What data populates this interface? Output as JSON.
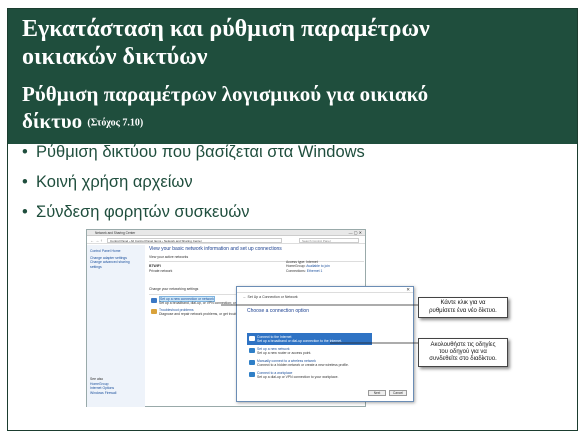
{
  "slide": {
    "title_line1": "Εγκατάσταση και ρύθμιση παραμέτρων",
    "title_line2": "οικιακών δικτύων",
    "subtitle_line1": "Ρύθμιση παραμέτρων λογισμικού για οικιακό",
    "subtitle_line2": "δίκτυο",
    "objective": "(Στόχος 7.10)",
    "bullets": [
      "Ρύθμιση δικτύου που βασίζεται στα Windows",
      "Κοινή χρήση αρχείων",
      "Σύνδεση φορητών συσκευών"
    ]
  },
  "screenshot": {
    "window_title": "Network and Sharing Center",
    "address": "Control Panel › All Control Panel Items › Network and Sharing Center",
    "search_placeholder": "Search Control Panel",
    "left_nav": [
      "Control Panel Home",
      "Change adapter settings",
      "Change advanced sharing",
      "settings"
    ],
    "left_bottom": [
      "See also",
      "HomeGroup",
      "Internet Options",
      "Windows Firewall"
    ],
    "heading": "View your basic network information and set up connections",
    "active_label": "View your active networks",
    "network_name": "BTWIFI",
    "network_type": "Private network",
    "access_type_label": "Access type:",
    "access_type_value": "Internet",
    "homegroup_label": "HomeGroup:",
    "homegroup_value": "Available to join",
    "connections_label": "Connections:",
    "connections_value": "Ethernet 1",
    "change_label": "Change your networking settings",
    "items": [
      {
        "title": "Set up a new connection or network",
        "desc": "Set up a broadband, dial-up, or VPN connection; or set up a router or access point."
      },
      {
        "title": "Troubleshoot problems",
        "desc": "Diagnose and repair network problems, or get troubleshooting information."
      }
    ]
  },
  "dialog": {
    "title": "Set Up a Connection or Network",
    "heading": "Choose a connection option",
    "options": [
      {
        "title": "Connect to the Internet",
        "desc": "Set up a broadband or dial-up connection to the Internet."
      },
      {
        "title": "Set up a new network",
        "desc": "Set up a new router or access point."
      },
      {
        "title": "Manually connect to a wireless network",
        "desc": "Connect to a hidden network or create a new wireless profile."
      },
      {
        "title": "Connect to a workplace",
        "desc": "Set up a dial-up or VPN connection to your workplace."
      }
    ],
    "next_label": "Next",
    "cancel_label": "Cancel"
  },
  "callouts": {
    "c1_line1": "Κάντε κλικ για να",
    "c1_line2": "ρυθμίσετε ένα νέο δίκτυο.",
    "c2_line1": "Ακολουθήστε τις οδηγίες",
    "c2_line2": "του οδηγού για να",
    "c2_line3": "συνδεθείτε στο διαδίκτυο."
  },
  "colors": {
    "header_bg": "#1f4e3d",
    "bullet_text": "#1f4e3d",
    "title_text": "#ffffff"
  }
}
